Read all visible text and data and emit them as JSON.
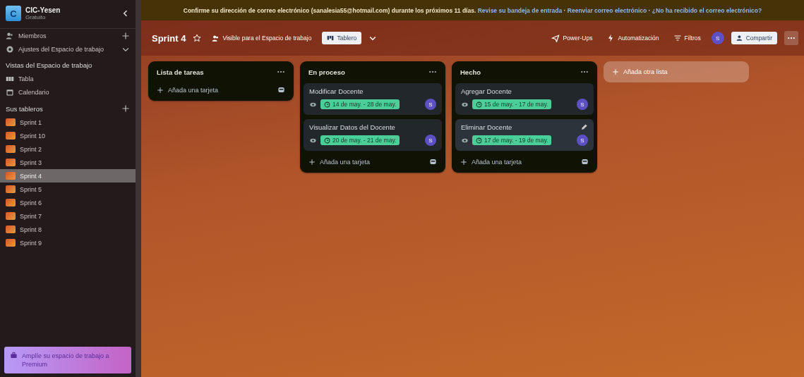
{
  "workspace": {
    "initial": "C",
    "name": "CIC-Yesen",
    "plan": "Gratuito"
  },
  "sidebar": {
    "nav": [
      {
        "label": "Miembros",
        "kind": "members"
      },
      {
        "label": "Ajustes del Espacio de trabajo",
        "kind": "settings"
      }
    ],
    "views_title": "Vistas del Espacio de trabajo",
    "views": [
      {
        "label": "Tabla",
        "kind": "table"
      },
      {
        "label": "Calendario",
        "kind": "calendar"
      }
    ],
    "boards_title": "Sus tableros",
    "boards": [
      {
        "name": "Sprint 1",
        "selected": false
      },
      {
        "name": "Sprint 10",
        "selected": false
      },
      {
        "name": "Sprint 2",
        "selected": false
      },
      {
        "name": "Sprint 3",
        "selected": false
      },
      {
        "name": "Sprint 4",
        "selected": true
      },
      {
        "name": "Sprint 5",
        "selected": false
      },
      {
        "name": "Sprint 6",
        "selected": false
      },
      {
        "name": "Sprint 7",
        "selected": false
      },
      {
        "name": "Sprint 8",
        "selected": false
      },
      {
        "name": "Sprint 9",
        "selected": false
      }
    ],
    "upgrade": "Amplíe su espacio de trabajo a Premium"
  },
  "banner": {
    "message": "Confirme su dirección de correo electrónico (sanalesia55@hotmail.com) durante los próximos 11 días.",
    "separator": "·",
    "links": [
      "Revise su bandeja de entrada",
      "Reenviar correo electrónico",
      "¿No ha recibido el correo electrónico?"
    ]
  },
  "board_header": {
    "title": "Sprint 4",
    "visibility": "Visible para el Espacio de trabajo",
    "view": "Tablero",
    "actions": [
      {
        "label": "Power-Ups",
        "kind": "rocket"
      },
      {
        "label": "Automatización",
        "kind": "bolt"
      },
      {
        "label": "Filtros",
        "kind": "filter"
      }
    ],
    "member": "S",
    "share": "Compartir"
  },
  "lists": [
    {
      "title": "Lista de tareas",
      "add_label": "Añada una tarjeta"
    },
    {
      "title": "En proceso",
      "cards": [
        {
          "title": "Modificar Docente",
          "dates": "14 de may. - 28 de may.",
          "member": "S",
          "hovered": false
        },
        {
          "title": "Visualizar Datos del Docente",
          "dates": "20 de may. - 21 de may.",
          "member": "S",
          "hovered": false
        }
      ],
      "add_label": "Añada una tarjeta"
    },
    {
      "title": "Hecho",
      "cards": [
        {
          "title": "Agregar Docente",
          "dates": "15 de may. - 17 de may.",
          "member": "S",
          "hovered": false
        },
        {
          "title": "Eliminar Docente",
          "dates": "17 de may. - 19 de may.",
          "member": "S",
          "hovered": true
        }
      ],
      "add_label": "Añada una tarjeta"
    }
  ],
  "add_list": "Añada otra lista"
}
